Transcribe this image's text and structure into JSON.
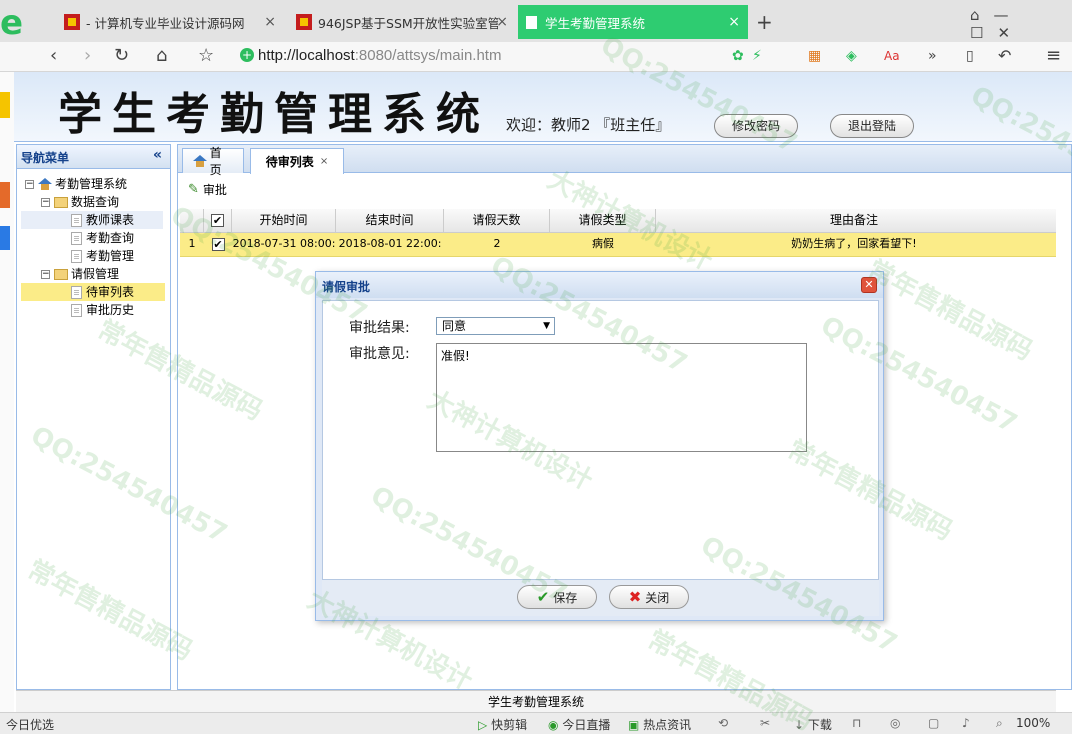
{
  "browser": {
    "tabs": [
      {
        "label": "- 计算机专业毕业设计源码网"
      },
      {
        "label": "946JSP基于SSM开放性实验室管"
      },
      {
        "label": "学生考勤管理系统"
      }
    ],
    "new_tab": "+",
    "url_host": "http://localhost",
    "url_rest": ":8080/attsys/main.htm"
  },
  "app": {
    "title": "学生考勤管理系统",
    "welcome": "欢迎：教师2 『班主任』",
    "change_password": "修改密码",
    "logout": "退出登陆",
    "footer": "学生考勤管理系统"
  },
  "nav": {
    "title": "导航菜单",
    "root": "考勤管理系统",
    "groups": [
      {
        "label": "数据查询",
        "items": [
          "教师课表",
          "考勤查询",
          "考勤管理"
        ]
      },
      {
        "label": "请假管理",
        "items": [
          "待审列表",
          "审批历史"
        ]
      }
    ]
  },
  "tabs": {
    "home": "首页",
    "pending": "待审列表"
  },
  "toolbar": {
    "approve": "审批"
  },
  "grid": {
    "headers": [
      "开始时间",
      "结束时间",
      "请假天数",
      "请假类型",
      "理由备注"
    ],
    "rows": [
      {
        "num": "1",
        "start": "2018-07-31 08:00:",
        "end": "2018-08-01 22:00:",
        "days": "2",
        "type": "病假",
        "reason": "奶奶生病了，回家看望下!"
      }
    ]
  },
  "dialog": {
    "title": "请假审批",
    "result_label": "审批结果:",
    "result_value": "同意",
    "opinion_label": "审批意见:",
    "opinion_value": "准假!",
    "save": "保存",
    "close": "关闭"
  },
  "status": {
    "left": "今日优选",
    "items": [
      "快剪辑",
      "今日直播",
      "热点资讯",
      "下载"
    ],
    "zoom": "100%"
  },
  "watermarks": [
    "QQ:254540457",
    "大神计算机设计",
    "常年售精品源码"
  ]
}
